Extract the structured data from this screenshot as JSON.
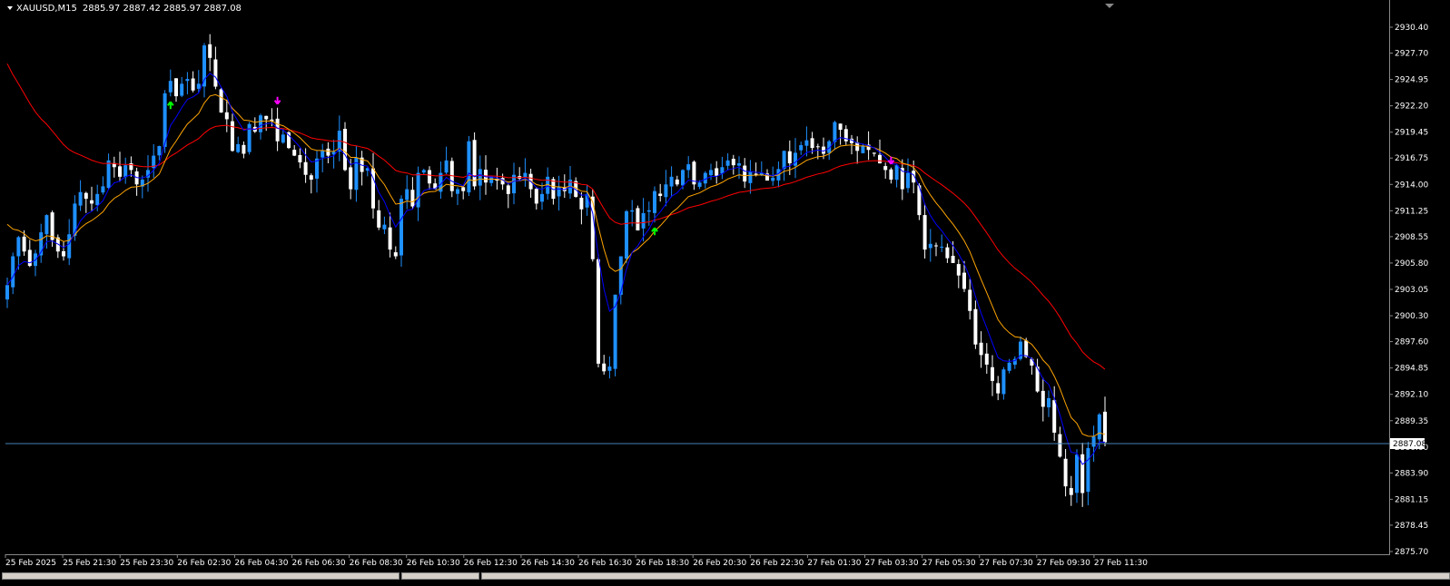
{
  "header": {
    "symbol": "XAUUSD,M15",
    "bid": "2885.97",
    "high": "2887.42",
    "low": "2885.97",
    "close": "2887.08"
  },
  "current_price_label": "2887.08",
  "colors": {
    "background": "#000000",
    "bull_candle": "#1e90ff",
    "bear_candle": "#ffffff",
    "ma_fast": "#0000ff",
    "ma_mid": "#ffa500",
    "ma_slow": "#ff0000",
    "buy_arrow": "#00ff00",
    "sell_arrow": "#ff00ff",
    "price_line": "#4682b4"
  },
  "chart_data": {
    "type": "candlestick",
    "symbol": "XAUUSD",
    "timeframe": "M15",
    "ylim": [
      2875.4,
      2931.5
    ],
    "y_ticks": [
      "2930.40",
      "2927.70",
      "2924.95",
      "2922.20",
      "2919.45",
      "2916.75",
      "2914.00",
      "2911.25",
      "2908.55",
      "2905.80",
      "2903.05",
      "2900.30",
      "2897.60",
      "2894.85",
      "2892.10",
      "2889.35",
      "2886.60",
      "2883.90",
      "2881.15",
      "2878.45",
      "2875.70"
    ],
    "x_ticks": [
      "25 Feb 2025",
      "25 Feb 21:30",
      "25 Feb 23:30",
      "26 Feb 02:30",
      "26 Feb 04:30",
      "26 Feb 06:30",
      "26 Feb 08:30",
      "26 Feb 10:30",
      "26 Feb 12:30",
      "26 Feb 14:30",
      "26 Feb 16:30",
      "26 Feb 18:30",
      "26 Feb 20:30",
      "26 Feb 22:30",
      "27 Feb 01:30",
      "27 Feb 03:30",
      "27 Feb 05:30",
      "27 Feb 07:30",
      "27 Feb 09:30",
      "27 Feb 11:30"
    ],
    "grid": false,
    "close_series": [
      2903.5,
      2906.5,
      2908.5,
      2907.0,
      2905.5,
      2906.8,
      2909.0,
      2910.8,
      2908.2,
      2907.0,
      2906.5,
      2908.8,
      2912.0,
      2913.2,
      2912.5,
      2912.0,
      2913.0,
      2913.8,
      2916.5,
      2915.8,
      2914.8,
      2916.0,
      2915.5,
      2914.0,
      2914.5,
      2915.5,
      2917.0,
      2918.0,
      2923.5,
      2924.8,
      2923.2,
      2924.5,
      2925.0,
      2923.8,
      2924.5,
      2928.5,
      2927.2,
      2924.2,
      2921.5,
      2920.8,
      2917.5,
      2918.2,
      2917.2,
      2920.3,
      2919.5,
      2921.2,
      2920.8,
      2920.6,
      2918.5,
      2919.2,
      2917.8,
      2917.0,
      2916.3,
      2915.0,
      2914.5,
      2916.7,
      2917.5,
      2917.0,
      2917.4,
      2919.6,
      2915.5,
      2913.5,
      2916.8,
      2915.3,
      2915.7,
      2911.5,
      2909.5,
      2909.8,
      2907.2,
      2906.5,
      2912.5,
      2913.5,
      2911.7,
      2915.2,
      2915.5,
      2914.1,
      2913.5,
      2915.2,
      2916.5,
      2913.3,
      2913.5,
      2913.3,
      2918.5,
      2913.8,
      2915.6,
      2914.2,
      2914.8,
      2914.4,
      2914.0,
      2913.0,
      2915.0,
      2914.6,
      2915.2,
      2913.5,
      2912.0,
      2913.0,
      2914.8,
      2912.5,
      2913.7,
      2913.3,
      2914.5,
      2912.7,
      2911.4,
      2913.0,
      2906.2,
      2895.3,
      2894.5,
      2895.0,
      2902.5,
      2906.5,
      2911.2,
      2911.3,
      2909.2,
      2911.0,
      2911.3,
      2913.3,
      2912.8,
      2914.0,
      2914.8,
      2914.0,
      2915.5,
      2916.1,
      2914.0,
      2914.2,
      2915.2,
      2915.5,
      2914.9,
      2915.8,
      2916.5,
      2916.0,
      2916.2,
      2914.3,
      2915.3,
      2915.0,
      2915.2,
      2914.4,
      2914.7,
      2915.6,
      2917.5,
      2916.2,
      2917.3,
      2918.1,
      2918.6,
      2917.8,
      2917.9,
      2917.2,
      2918.5,
      2920.5,
      2919.7,
      2918.5,
      2918.3,
      2917.5,
      2918.0,
      2917.6,
      2917.2,
      2916.2,
      2915.5,
      2914.5,
      2916.0,
      2913.5,
      2915.2,
      2914.2,
      2910.8,
      2907.2,
      2907.8,
      2907.6,
      2907.5,
      2906.3,
      2905.8,
      2904.5,
      2903.1,
      2900.8,
      2897.3,
      2896.2,
      2895.2,
      2893.5,
      2892.2,
      2894.7,
      2895.4,
      2895.8,
      2897.6,
      2896.0,
      2895.1,
      2892.4,
      2890.8,
      2891.7,
      2888.1,
      2885.6,
      2882.5,
      2881.6,
      2885.8,
      2881.8,
      2886.5,
      2887.7,
      2890.0,
      2887.1
    ]
  },
  "signals": [
    {
      "type": "buy",
      "label": "buy-arrow"
    },
    {
      "type": "sell",
      "label": "sell-arrow"
    },
    {
      "type": "buy",
      "label": "buy-arrow"
    },
    {
      "type": "sell",
      "label": "sell-arrow"
    }
  ]
}
